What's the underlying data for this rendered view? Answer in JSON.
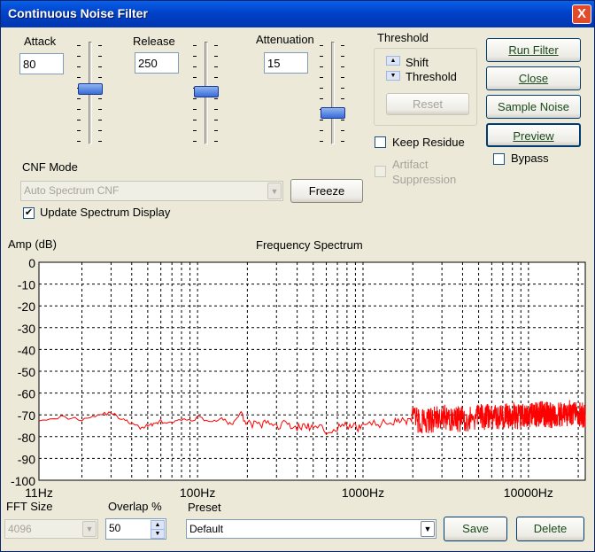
{
  "window": {
    "title": "Continuous Noise Filter",
    "close_glyph": "X"
  },
  "sliders": {
    "attack": {
      "label": "Attack",
      "value": "80",
      "level": 0.55
    },
    "release": {
      "label": "Release",
      "value": "250",
      "level": 0.52
    },
    "attenuation": {
      "label": "Attenuation",
      "value": "15",
      "level": 0.28
    }
  },
  "threshold": {
    "group_label": "Threshold",
    "shift_label": "Shift",
    "threshold_label": "Threshold",
    "reset_label": "Reset"
  },
  "buttons": {
    "run_filter": "Run Filter",
    "close": "Close",
    "sample_noise": "Sample Noise",
    "preview": "Preview",
    "freeze": "Freeze",
    "save": "Save",
    "delete": "Delete"
  },
  "checks": {
    "keep_residue": {
      "label": "Keep Residue",
      "checked": false
    },
    "artifact_suppression": {
      "label": "Artifact\nSuppression",
      "line1": "Artifact",
      "line2": "Suppression",
      "checked": false,
      "disabled": true
    },
    "bypass": {
      "label": "Bypass",
      "checked": false
    },
    "update_spectrum": {
      "label": "Update Spectrum Display",
      "checked": true
    }
  },
  "cnf_mode": {
    "label": "CNF Mode",
    "value": "Auto Spectrum CNF"
  },
  "chart_data": {
    "type": "line",
    "title": "Frequency Spectrum",
    "ylabel": "Amp (dB)",
    "xlabel": "",
    "xscale": "log",
    "xlim": [
      11,
      22050
    ],
    "ylim": [
      -100,
      0
    ],
    "y_ticks": [
      "0",
      "-10",
      "-20",
      "-30",
      "-40",
      "-50",
      "-60",
      "-70",
      "-80",
      "-90",
      "-100"
    ],
    "x_ticks": [
      "11Hz",
      "100Hz",
      "1000Hz",
      "10000Hz"
    ],
    "grid": true,
    "series": [
      {
        "color": "#ff0000",
        "x": [
          11,
          15,
          20,
          25,
          30,
          35,
          40,
          45,
          50,
          55,
          60,
          70,
          80,
          90,
          100,
          120,
          140,
          160,
          180,
          200,
          230,
          260,
          300,
          350,
          400,
          450,
          500,
          600,
          700,
          800,
          900,
          1000,
          1200,
          1400,
          1600,
          1800,
          2000,
          2500,
          3000,
          3500,
          4000,
          5000,
          6000,
          7000,
          8000,
          9000,
          10000,
          11000,
          12000,
          13000,
          14000,
          16000,
          18000,
          20000,
          22050
        ],
        "y": [
          -72,
          -71,
          -72,
          -70,
          -69,
          -72,
          -74,
          -76,
          -75,
          -74,
          -73,
          -74,
          -72,
          -73,
          -71,
          -73,
          -72,
          -74,
          -70,
          -73,
          -75,
          -74,
          -75,
          -74,
          -76,
          -75,
          -76,
          -77,
          -76,
          -75,
          -76,
          -75,
          -74,
          -74,
          -72,
          -73,
          -72,
          -73,
          -71,
          -72,
          -72,
          -71,
          -71,
          -71,
          -70,
          -71,
          -70,
          -70,
          -69,
          -70,
          -70,
          -70,
          -69,
          -70,
          -70
        ]
      }
    ]
  },
  "bottom": {
    "fft_label": "FFT Size",
    "fft_value": "4096",
    "overlap_label": "Overlap %",
    "overlap_value": "50",
    "preset_label": "Preset",
    "preset_value": "Default"
  },
  "colors": {
    "titlebar": "#0050d8",
    "trace": "#ff0000",
    "dialog_bg": "#ece9d8"
  }
}
